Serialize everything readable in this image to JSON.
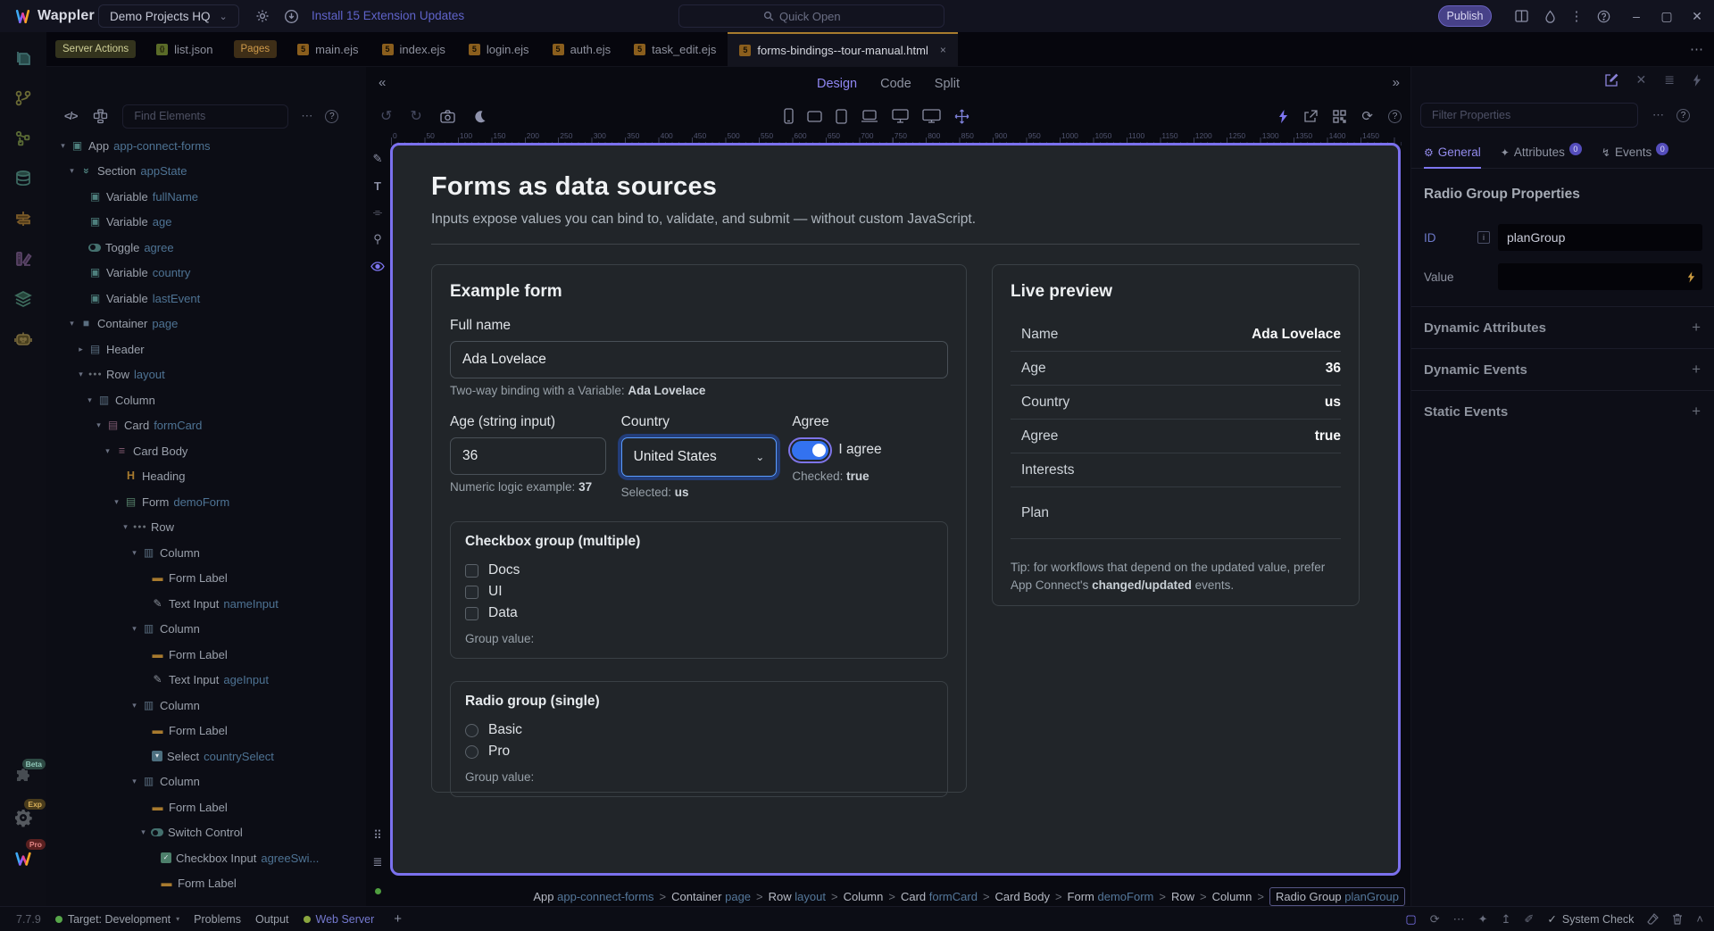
{
  "topbar": {
    "app_name": "Wappler",
    "project_name": "Demo Projects HQ",
    "updates_link": "Install 15 Extension Updates",
    "quick_open_placeholder": "Quick Open",
    "publish_label": "Publish"
  },
  "tabbar": {
    "tabs": [
      {
        "label": "Server Actions",
        "kind": "chip-olive"
      },
      {
        "label": "list.json",
        "kind": "file",
        "icon": "json"
      },
      {
        "label": "Pages",
        "kind": "chip-amber"
      },
      {
        "label": "main.ejs",
        "kind": "file",
        "icon": "ejs"
      },
      {
        "label": "index.ejs",
        "kind": "file",
        "icon": "ejs"
      },
      {
        "label": "login.ejs",
        "kind": "file",
        "icon": "ejs"
      },
      {
        "label": "auth.ejs",
        "kind": "file",
        "icon": "ejs"
      },
      {
        "label": "task_edit.ejs",
        "kind": "file",
        "icon": "ejs"
      },
      {
        "label": "forms-bindings--tour-manual.html",
        "kind": "file",
        "icon": "ejs",
        "active": true,
        "close": "×"
      }
    ]
  },
  "leftrail": {
    "badges": [
      "Beta",
      "Exp",
      "Pro"
    ]
  },
  "tree": {
    "find_placeholder": "Find Elements",
    "items": [
      {
        "level": 0,
        "exp": "open",
        "icon": "cube",
        "type": "App",
        "name": "app-connect-forms"
      },
      {
        "level": 1,
        "exp": "open",
        "icon": "section",
        "type": "Section",
        "name": "appState"
      },
      {
        "level": 2,
        "icon": "cube",
        "type": "Variable",
        "name": "fullName"
      },
      {
        "level": 2,
        "icon": "cube",
        "type": "Variable",
        "name": "age"
      },
      {
        "level": 2,
        "icon": "toggle",
        "type": "Toggle",
        "name": "agree"
      },
      {
        "level": 2,
        "icon": "cube",
        "type": "Variable",
        "name": "country"
      },
      {
        "level": 2,
        "icon": "cube",
        "type": "Variable",
        "name": "lastEvent"
      },
      {
        "level": 1,
        "exp": "open",
        "icon": "container",
        "type": "Container",
        "name": "page"
      },
      {
        "level": 2,
        "exp": "closed",
        "icon": "header",
        "type": "Header",
        "name": ""
      },
      {
        "level": 2,
        "exp": "open",
        "icon": "dots",
        "type": "Row",
        "name": "layout"
      },
      {
        "level": 3,
        "exp": "open",
        "icon": "columns",
        "type": "Column",
        "name": ""
      },
      {
        "level": 4,
        "exp": "open",
        "icon": "card",
        "type": "Card",
        "name": "formCard"
      },
      {
        "level": 5,
        "exp": "open",
        "icon": "lines",
        "type": "Card Body",
        "name": ""
      },
      {
        "level": 6,
        "icon": "heading",
        "type": "Heading",
        "name": ""
      },
      {
        "level": 6,
        "exp": "open",
        "icon": "form",
        "type": "Form",
        "name": "demoForm"
      },
      {
        "level": 7,
        "exp": "open",
        "icon": "dots",
        "type": "Row",
        "name": ""
      },
      {
        "level": 8,
        "exp": "open",
        "icon": "columns",
        "type": "Column",
        "name": ""
      },
      {
        "level": 9,
        "icon": "dash",
        "type": "Form Label",
        "name": ""
      },
      {
        "level": 9,
        "icon": "pencil",
        "type": "Text Input",
        "name": "nameInput"
      },
      {
        "level": 8,
        "exp": "open",
        "icon": "columns",
        "type": "Column",
        "name": ""
      },
      {
        "level": 9,
        "icon": "dash",
        "type": "Form Label",
        "name": ""
      },
      {
        "level": 9,
        "icon": "pencil",
        "type": "Text Input",
        "name": "ageInput"
      },
      {
        "level": 8,
        "exp": "open",
        "icon": "columns",
        "type": "Column",
        "name": ""
      },
      {
        "level": 9,
        "icon": "dash",
        "type": "Form Label",
        "name": ""
      },
      {
        "level": 9,
        "icon": "select",
        "type": "Select",
        "name": "countrySelect"
      },
      {
        "level": 8,
        "exp": "open",
        "icon": "columns",
        "type": "Column",
        "name": ""
      },
      {
        "level": 9,
        "icon": "dash",
        "type": "Form Label",
        "name": ""
      },
      {
        "level": 9,
        "exp": "open",
        "icon": "toggle",
        "type": "Switch Control",
        "name": ""
      },
      {
        "level": 10,
        "icon": "checkbox",
        "type": "Checkbox Input",
        "name": "agreeSwi..."
      },
      {
        "level": 10,
        "icon": "dash",
        "type": "Form Label",
        "name": ""
      }
    ]
  },
  "canvas": {
    "view_tabs": [
      {
        "label": "Design",
        "active": true
      },
      {
        "label": "Code",
        "active": false
      },
      {
        "label": "Split",
        "active": false
      }
    ],
    "ruler": {
      "start": 0,
      "end": 1450,
      "step": 50
    }
  },
  "page": {
    "title": "Forms as data sources",
    "subtitle": "Inputs expose values you can bind to, validate, and submit — without custom JavaScript.",
    "form": {
      "title": "Example form",
      "full_name_label": "Full name",
      "full_name_value": "Ada Lovelace",
      "full_name_help_prefix": "Two-way binding with a Variable: ",
      "full_name_help_value": "Ada Lovelace",
      "age_label": "Age (string input)",
      "age_value": "36",
      "age_help_prefix": "Numeric logic example: ",
      "age_help_value": "37",
      "country_label": "Country",
      "country_value": "United States",
      "country_help_prefix": "Selected: ",
      "country_help_value": "us",
      "agree_label": "Agree",
      "agree_text": "I agree",
      "agree_help_prefix": "Checked: ",
      "agree_help_value": "true",
      "checkbox_group": {
        "title": "Checkbox group (multiple)",
        "options": [
          "Docs",
          "UI",
          "Data"
        ],
        "group_value_label": "Group value:"
      },
      "radio_group": {
        "title": "Radio group (single)",
        "options": [
          "Basic",
          "Pro"
        ],
        "group_value_label": "Group value:"
      }
    },
    "preview": {
      "title": "Live preview",
      "rows": [
        {
          "label": "Name",
          "value": "Ada Lovelace"
        },
        {
          "label": "Age",
          "value": "36"
        },
        {
          "label": "Country",
          "value": "us"
        },
        {
          "label": "Agree",
          "value": "true"
        },
        {
          "label": "Interests",
          "value": ""
        },
        {
          "label": "Plan",
          "value": "",
          "tall": true
        }
      ],
      "tip_prefix": "Tip: for workflows that depend on the updated value, prefer App Connect's ",
      "tip_bold": "changed/updated",
      "tip_suffix": " events."
    }
  },
  "properties": {
    "filter_placeholder": "Filter Properties",
    "tabs": [
      {
        "label": "General",
        "active": true
      },
      {
        "label": "Attributes",
        "badge": "0"
      },
      {
        "label": "Events",
        "badge": "0"
      }
    ],
    "section_title": "Radio Group Properties",
    "id_label": "ID",
    "id_value": "planGroup",
    "value_label": "Value",
    "value_value": "",
    "sections": [
      "Dynamic Attributes",
      "Dynamic Events",
      "Static Events"
    ]
  },
  "breadcrumb": {
    "separator": ">",
    "items": [
      {
        "type": "App",
        "name": "app-connect-forms"
      },
      {
        "type": "Container",
        "name": "page"
      },
      {
        "type": "Row",
        "name": "layout"
      },
      {
        "type": "Column",
        "name": ""
      },
      {
        "type": "Card",
        "name": "formCard"
      },
      {
        "type": "Card Body",
        "name": ""
      },
      {
        "type": "Form",
        "name": "demoForm"
      },
      {
        "type": "Row",
        "name": ""
      },
      {
        "type": "Column",
        "name": ""
      },
      {
        "type": "Radio Group",
        "name": "planGroup",
        "boxed": true
      }
    ]
  },
  "statusbar": {
    "version": "7.7.9",
    "target": "Target: Development",
    "problems": "Problems",
    "output": "Output",
    "web_server": "Web Server",
    "system_check": "System Check"
  }
}
